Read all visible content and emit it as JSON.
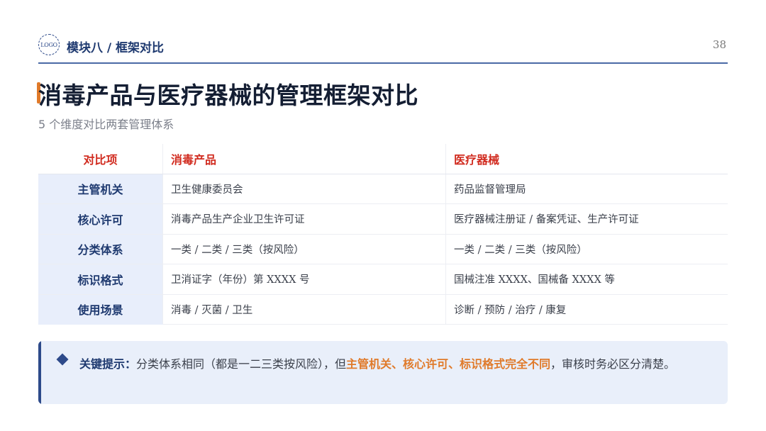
{
  "header": {
    "logo_text": "LOGO",
    "module": "模块八 / 框架对比",
    "page_number": "38"
  },
  "title": "消毒产品与医疗器械的管理框架对比",
  "subtitle": "5 个维度对比两套管理体系",
  "table": {
    "headers": [
      "对比项",
      "消毒产品",
      "医疗器械"
    ],
    "rows": [
      [
        "主管机关",
        "卫生健康委员会",
        "药品监督管理局"
      ],
      [
        "核心许可",
        "消毒产品生产企业卫生许可证",
        "医疗器械注册证 / 备案凭证、生产许可证"
      ],
      [
        "分类体系",
        "一类 / 二类 / 三类（按风险）",
        "一类 / 二类 / 三类（按风险）"
      ],
      [
        "标识格式",
        "卫消证字（年份）第 XXXX 号",
        "国械注准 XXXX、国械备 XXXX 等"
      ],
      [
        "使用场景",
        "消毒 / 灭菌 / 卫生",
        "诊断 / 预防 / 治疗 / 康复"
      ]
    ]
  },
  "tip": {
    "icon": "diamond-icon",
    "label": "关键提示：",
    "text_before": "分类体系相同（都是一二三类按风险），但",
    "highlight": "主管机关、核心许可、标识格式完全不同",
    "text_after": "，审核时务必区分清楚。"
  },
  "colors": {
    "primary": "#1f3a70",
    "accent": "#e07a2a",
    "header_red": "#d12b1f",
    "label_bg": "#e8eefb",
    "tip_bg": "#e9effa"
  }
}
